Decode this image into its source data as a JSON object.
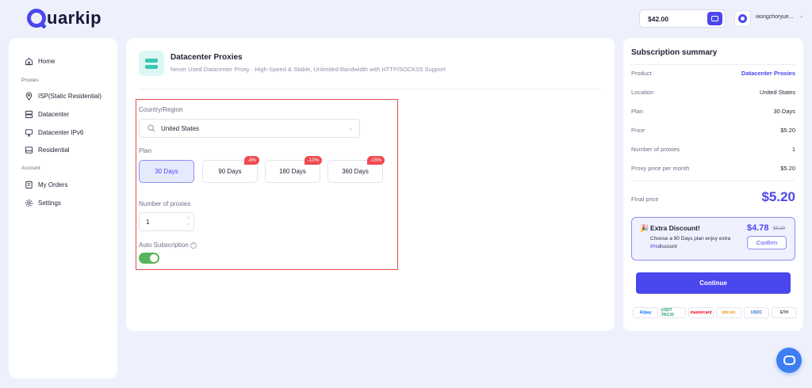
{
  "brand": {
    "name": "uarkip",
    "accent": "#4b47ee"
  },
  "header": {
    "balance": "$42.00",
    "username": "wongchoryue..."
  },
  "sidebar": {
    "home": "Home",
    "proxies_section": "Proxies",
    "items": [
      {
        "label": "ISP(Static Residential)",
        "icon": "location-pin-icon"
      },
      {
        "label": "Datacenter",
        "icon": "server-icon"
      },
      {
        "label": "Datacenter IPv6",
        "icon": "monitor-icon"
      },
      {
        "label": "Residential",
        "icon": "storage-icon"
      }
    ],
    "account_section": "Account",
    "orders": "My Orders",
    "settings": "Settings"
  },
  "product": {
    "title": "Datacenter Proxies",
    "subtitle": "Never Used Datacenter Proxy · High-Speed & Stable, Unlimited Bandwidth with HTTP/SOCKS5 Support"
  },
  "form": {
    "country_label": "Country/Region",
    "country_value": "United States",
    "plan_label": "Plan",
    "plans": [
      {
        "label": "30 Days",
        "badge": ""
      },
      {
        "label": "90 Days",
        "badge": "-8%"
      },
      {
        "label": "180 Days",
        "badge": "-10%"
      },
      {
        "label": "360 Days",
        "badge": "-15%"
      }
    ],
    "selected_plan": "30 Days",
    "qty_label": "Number of proxies",
    "qty_value": "1",
    "auto_label": "Auto Subscription",
    "auto_enabled": true
  },
  "summary": {
    "title": "Subscription summary",
    "rows": [
      {
        "k": "Product",
        "v": "Datacenter Proxies"
      },
      {
        "k": "Location",
        "v": "United States"
      },
      {
        "k": "Plan",
        "v": "30 Days"
      },
      {
        "k": "Price",
        "v": "$5.20"
      },
      {
        "k": "Number of proxies",
        "v": "1"
      },
      {
        "k": "Proxy price per month",
        "v": "$5.20"
      }
    ],
    "final_label": "Final price",
    "final_price": "$5.20",
    "discount": {
      "title": "Extra Discount!",
      "text": "Choose a 90 Days plan enjoy extra",
      "pct": "8%",
      "suffix": "discount",
      "price": "$4.78",
      "old_price": "$5.20",
      "confirm": "Confirm"
    },
    "continue": "Continue",
    "payments": [
      "Alipay",
      "USDT TRC20",
      "mastercard",
      "bitcoin",
      "USDC",
      "ETH"
    ]
  }
}
